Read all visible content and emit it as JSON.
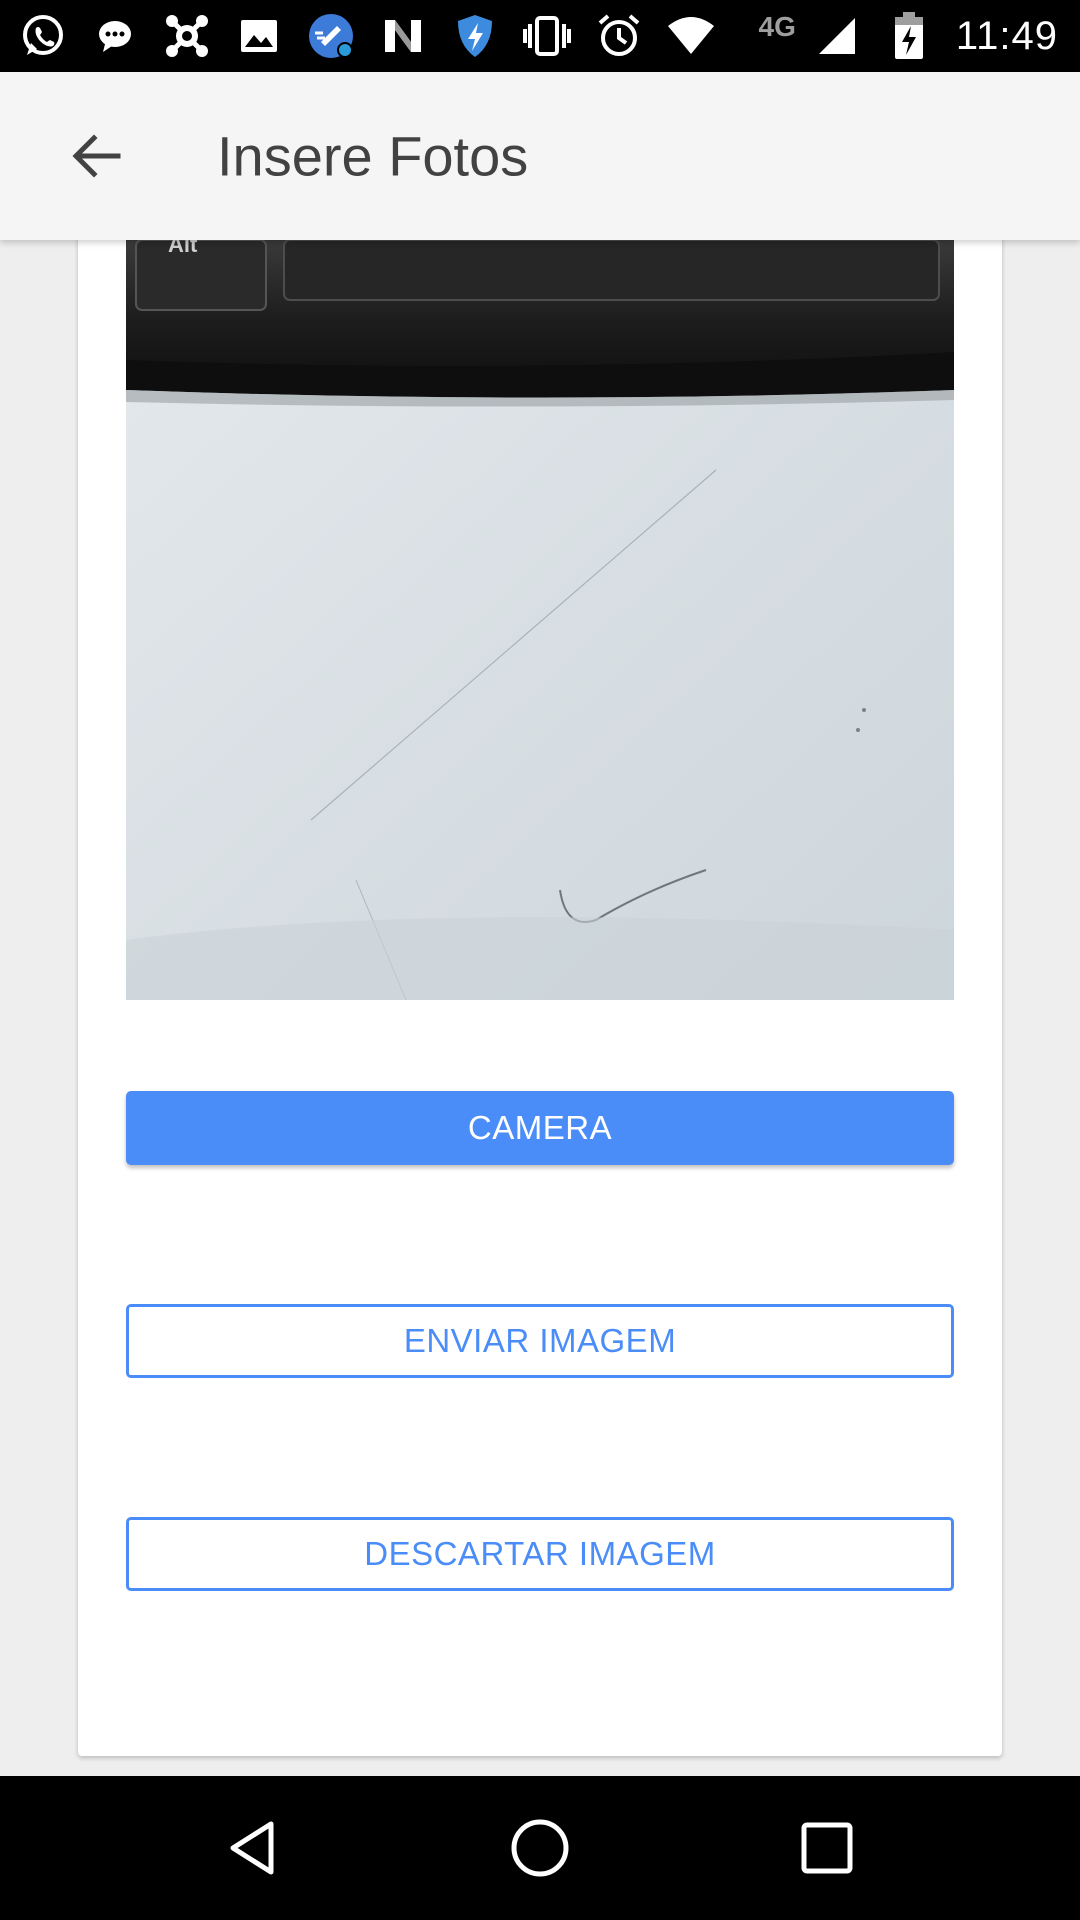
{
  "status_bar": {
    "time": "11:49",
    "network": "4G",
    "icons": [
      "whatsapp-icon",
      "messaging-icon",
      "avast-icon",
      "gallery-icon",
      "cleaner-icon",
      "n-app-icon",
      "shield-icon",
      "vibrate-icon",
      "alarm-icon",
      "wifi-icon",
      "signal-icon",
      "battery-charging-icon"
    ]
  },
  "app_bar": {
    "title": "Insere Fotos",
    "back_icon": "arrow-back-icon"
  },
  "photo": {
    "keyboard_key_label": "Alt"
  },
  "buttons": {
    "camera": "CAMERA",
    "enviar": "ENVIAR IMAGEM",
    "descartar": "DESCARTAR IMAGEM"
  },
  "colors": {
    "primary": "#4b8df8",
    "app_bar_bg": "#f5f5f5",
    "title_text": "#424242"
  },
  "nav_bar": {
    "icons": [
      "back-triangle-icon",
      "home-circle-icon",
      "recents-square-icon"
    ]
  }
}
